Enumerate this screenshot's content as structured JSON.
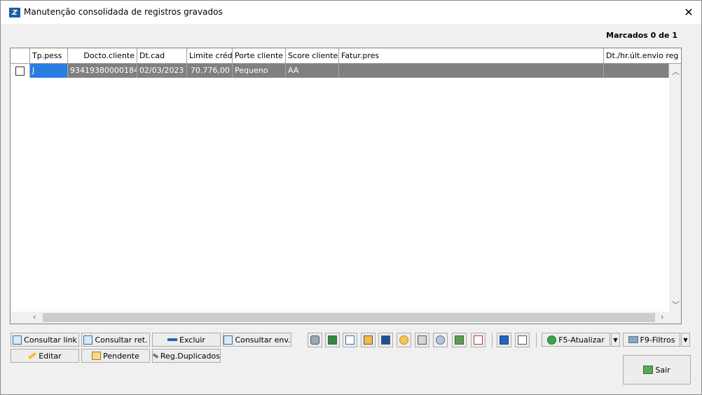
{
  "window": {
    "title": "Manutenção consolidada de registros gravados",
    "close_glyph": "✕"
  },
  "marked_label": "Marcados 0 de 1",
  "grid": {
    "columns": [
      "Tp.pess",
      "Docto.cliente",
      "Dt.cad",
      "Limite créd",
      "Porte cliente",
      "Score cliente",
      "Fatur.pres",
      "Dt./hr.últ.envio reg"
    ],
    "rows": [
      {
        "checked": false,
        "tp_pess": "J",
        "docto_cliente": "93419380000184",
        "dt_cad": "02/03/2023",
        "limite_cred": "70.776,00",
        "porte_cliente": "Pequeno",
        "score_cliente": "AA",
        "fatur_pres": "",
        "dt_envio": ""
      }
    ]
  },
  "buttons": {
    "consultar_link": "Consultar link",
    "consultar_ret": "Consultar ret.",
    "excluir": "Excluir",
    "consultar_env": "Consultar env.",
    "editar": "Editar",
    "pendente": "Pendente",
    "reg_duplicados": "Reg.Duplicados",
    "atualizar": "F5-Atualizar",
    "filtros": "F9-Filtros",
    "sair": "Sair"
  },
  "toolbar_icons": [
    "binoculars-icon",
    "excel-icon",
    "document-icon",
    "folder-chart-icon",
    "column-chart-icon",
    "palette-icon",
    "print-icon",
    "settings-icon",
    "download-icon",
    "checklist-icon"
  ],
  "colors": {
    "selected_row": "#808080",
    "window_bg": "#f0f0f0"
  }
}
